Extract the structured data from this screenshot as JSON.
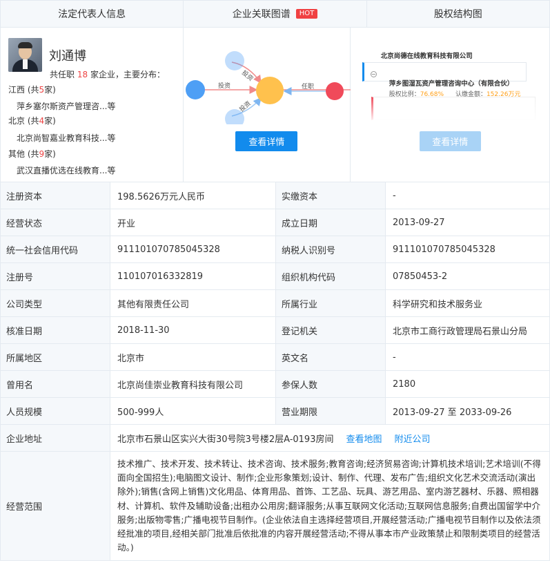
{
  "tabs": {
    "legal_rep": "法定代表人信息",
    "relation_graph": "企业关联图谱",
    "hot_badge": "HOT",
    "equity": "股权结构图"
  },
  "person": {
    "name": "刘通博",
    "stat_prefix": "共任职",
    "stat_count": "18",
    "stat_suffix": "家企业，主要分布：",
    "regions": [
      {
        "label": "江西 (共",
        "count": "5",
        "unit": "家)",
        "company": "萍乡塞尔斯资产管理咨...等"
      },
      {
        "label": "北京 (共",
        "count": "4",
        "unit": "家)",
        "company": "北京尚智嘉业教育科技...等"
      },
      {
        "label": "其他 (共",
        "count": "9",
        "unit": "家)",
        "company": "武汉直播优选在线教育...等"
      }
    ]
  },
  "graph": {
    "label_invest_1": "投资",
    "label_invest_2": "投资",
    "label_invest_3": "投资",
    "label_role": "任职",
    "button": "查看详情"
  },
  "equity": {
    "company": "北京尚德在线教育科技有限公司",
    "shareholder": "萍乡图湿瓦资产管理咨询中心（有限合伙）",
    "ratio_label": "股权比例：",
    "ratio_value": "76.68%",
    "amount_label": "认缴金额：",
    "amount_value": "152.26万元",
    "button": "查看详情"
  },
  "rows": [
    {
      "l1": "注册资本",
      "v1": "198.5626万元人民币",
      "l2": "实缴资本",
      "v2": "-"
    },
    {
      "l1": "经营状态",
      "v1": "开业",
      "l2": "成立日期",
      "v2": "2013-09-27"
    },
    {
      "l1": "统一社会信用代码",
      "v1": "911101070785045328",
      "l2": "纳税人识别号",
      "v2": "911101070785045328"
    },
    {
      "l1": "注册号",
      "v1": "110107016332819",
      "l2": "组织机构代码",
      "v2": "07850453-2"
    },
    {
      "l1": "公司类型",
      "v1": "其他有限责任公司",
      "l2": "所属行业",
      "v2": "科学研究和技术服务业"
    },
    {
      "l1": "核准日期",
      "v1": "2018-11-30",
      "l2": "登记机关",
      "v2": "北京市工商行政管理局石景山分局"
    },
    {
      "l1": "所属地区",
      "v1": "北京市",
      "l2": "英文名",
      "v2": "-"
    },
    {
      "l1": "曾用名",
      "v1": "北京尚佳崇业教育科技有限公司",
      "l2": "参保人数",
      "v2": "2180"
    },
    {
      "l1": "人员规模",
      "v1": "500-999人",
      "l2": "营业期限",
      "v2": "2013-09-27 至 2033-09-26"
    }
  ],
  "address": {
    "label": "企业地址",
    "value": "北京市石景山区实兴大街30号院3号楼2层A-0193房间",
    "map_link": "查看地图",
    "nearby_link": "附近公司"
  },
  "scope": {
    "label": "经营范围",
    "value": "技术推广、技术开发、技术转让、技术咨询、技术服务;教育咨询;经济贸易咨询;计算机技术培训;艺术培训(不得面向全国招生);电脑图文设计、制作;企业形象策划;设计、制作、代理、发布广告;组织文化艺术交流活动(演出除外);销售(含网上销售)文化用品、体育用品、首饰、工艺品、玩具、游艺用品、室内游艺器材、乐器、照相器材、计算机、软件及辅助设备;出租办公用房;翻译服务;从事互联网文化活动;互联网信息服务;自费出国留学中介服务;出版物零售;广播电视节目制作。(企业依法自主选择经营项目,开展经营活动;广播电视节目制作以及依法须经批准的项目,经相关部门批准后依批准的内容开展经营活动;不得从事本市产业政策禁止和限制类项目的经营活动。)"
  },
  "colors": {
    "accent": "#128bed",
    "red": "#e44",
    "orange": "#ff9f17",
    "label_bg": "#f5f8fb",
    "node_blue": "#4e9ff5",
    "node_orange": "#ffc14d",
    "node_red": "#f04a5a"
  }
}
